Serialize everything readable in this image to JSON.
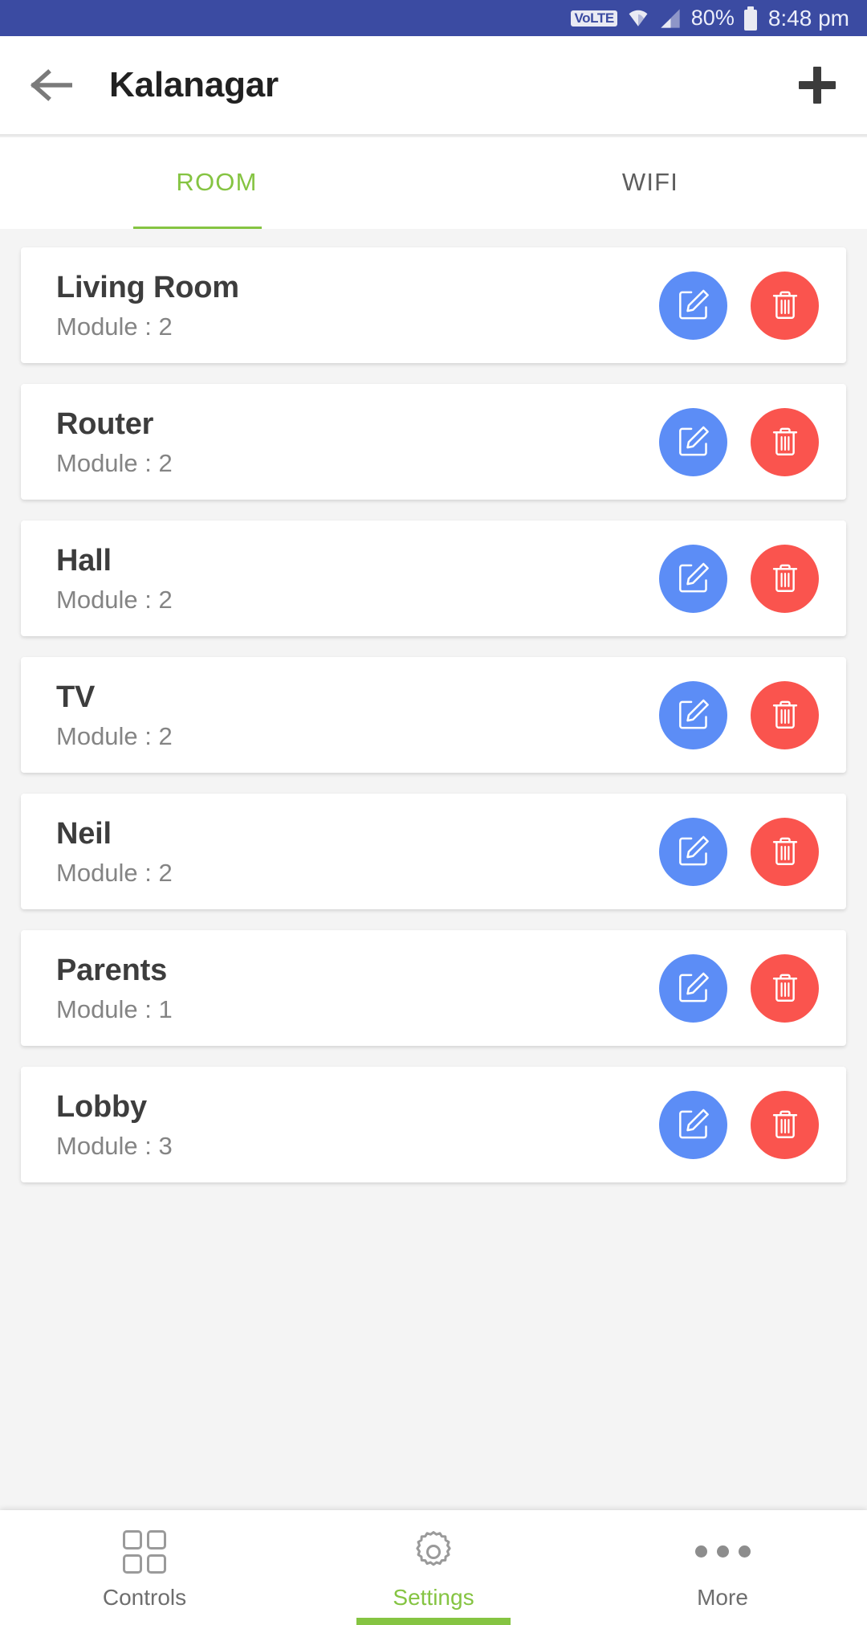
{
  "status_bar": {
    "volte": "VoLTE",
    "wifi_icon": "wifi-icon",
    "signal_icon": "signal-bars-icon",
    "battery_percent": "80%",
    "battery_icon": "battery-icon",
    "time": "8:48 pm",
    "background_color": "#3b4ba2"
  },
  "app_bar": {
    "back_icon": "back-arrow-icon",
    "title": "Kalanagar",
    "add_icon": "plus-icon"
  },
  "tabs": {
    "items": [
      {
        "label": "ROOM",
        "active": true
      },
      {
        "label": "WIFI",
        "active": false
      }
    ],
    "active_color": "#85c442",
    "inactive_color": "#5e5e5e"
  },
  "rooms": {
    "module_prefix": "Module : ",
    "edit_icon": "edit-pencil-icon",
    "delete_icon": "trash-icon",
    "edit_color": "#5c8df6",
    "delete_color": "#fa544e",
    "items": [
      {
        "name": "Living Room",
        "module_label": "Module : 2"
      },
      {
        "name": "Router",
        "module_label": "Module : 2"
      },
      {
        "name": "Hall",
        "module_label": "Module : 2"
      },
      {
        "name": "TV",
        "module_label": "Module : 2"
      },
      {
        "name": "Neil",
        "module_label": "Module : 2"
      },
      {
        "name": "Parents",
        "module_label": "Module : 1"
      },
      {
        "name": "Lobby",
        "module_label": "Module : 3"
      }
    ]
  },
  "bottom_nav": {
    "items": [
      {
        "label": "Controls",
        "icon": "grid-icon",
        "active": false
      },
      {
        "label": "Settings",
        "icon": "gear-icon",
        "active": true
      },
      {
        "label": "More",
        "icon": "more-dots-icon",
        "active": false
      }
    ],
    "active_color": "#85c442"
  }
}
